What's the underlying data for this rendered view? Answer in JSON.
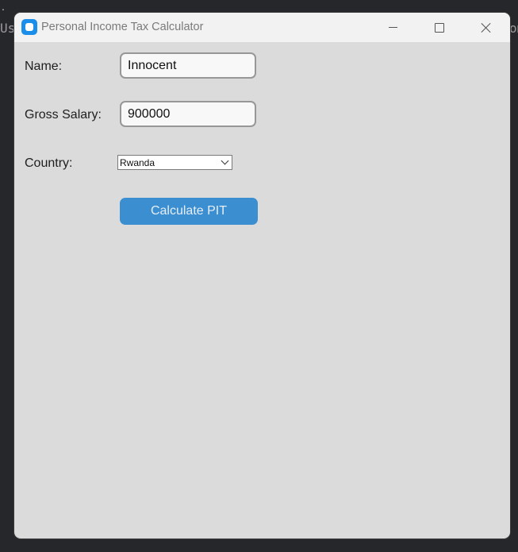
{
  "background": {
    "left_text": "Us",
    "right_text": "om",
    "dot": "."
  },
  "window": {
    "title": "Personal Income Tax Calculator",
    "icon": "app-icon",
    "controls": {
      "minimize": "minimize-icon",
      "maximize": "maximize-icon",
      "close": "close-icon"
    }
  },
  "form": {
    "name_label": "Name:",
    "name_value": "Innocent",
    "salary_label": "Gross Salary:",
    "salary_value": "900000",
    "country_label": "Country:",
    "country_selected": "Rwanda",
    "calculate_label": "Calculate PIT"
  },
  "colors": {
    "accent": "#3b8ed0",
    "window_bg": "#dbdbdb",
    "titlebar_bg": "#f2f2f2",
    "app_icon": "#1a8ee8"
  }
}
